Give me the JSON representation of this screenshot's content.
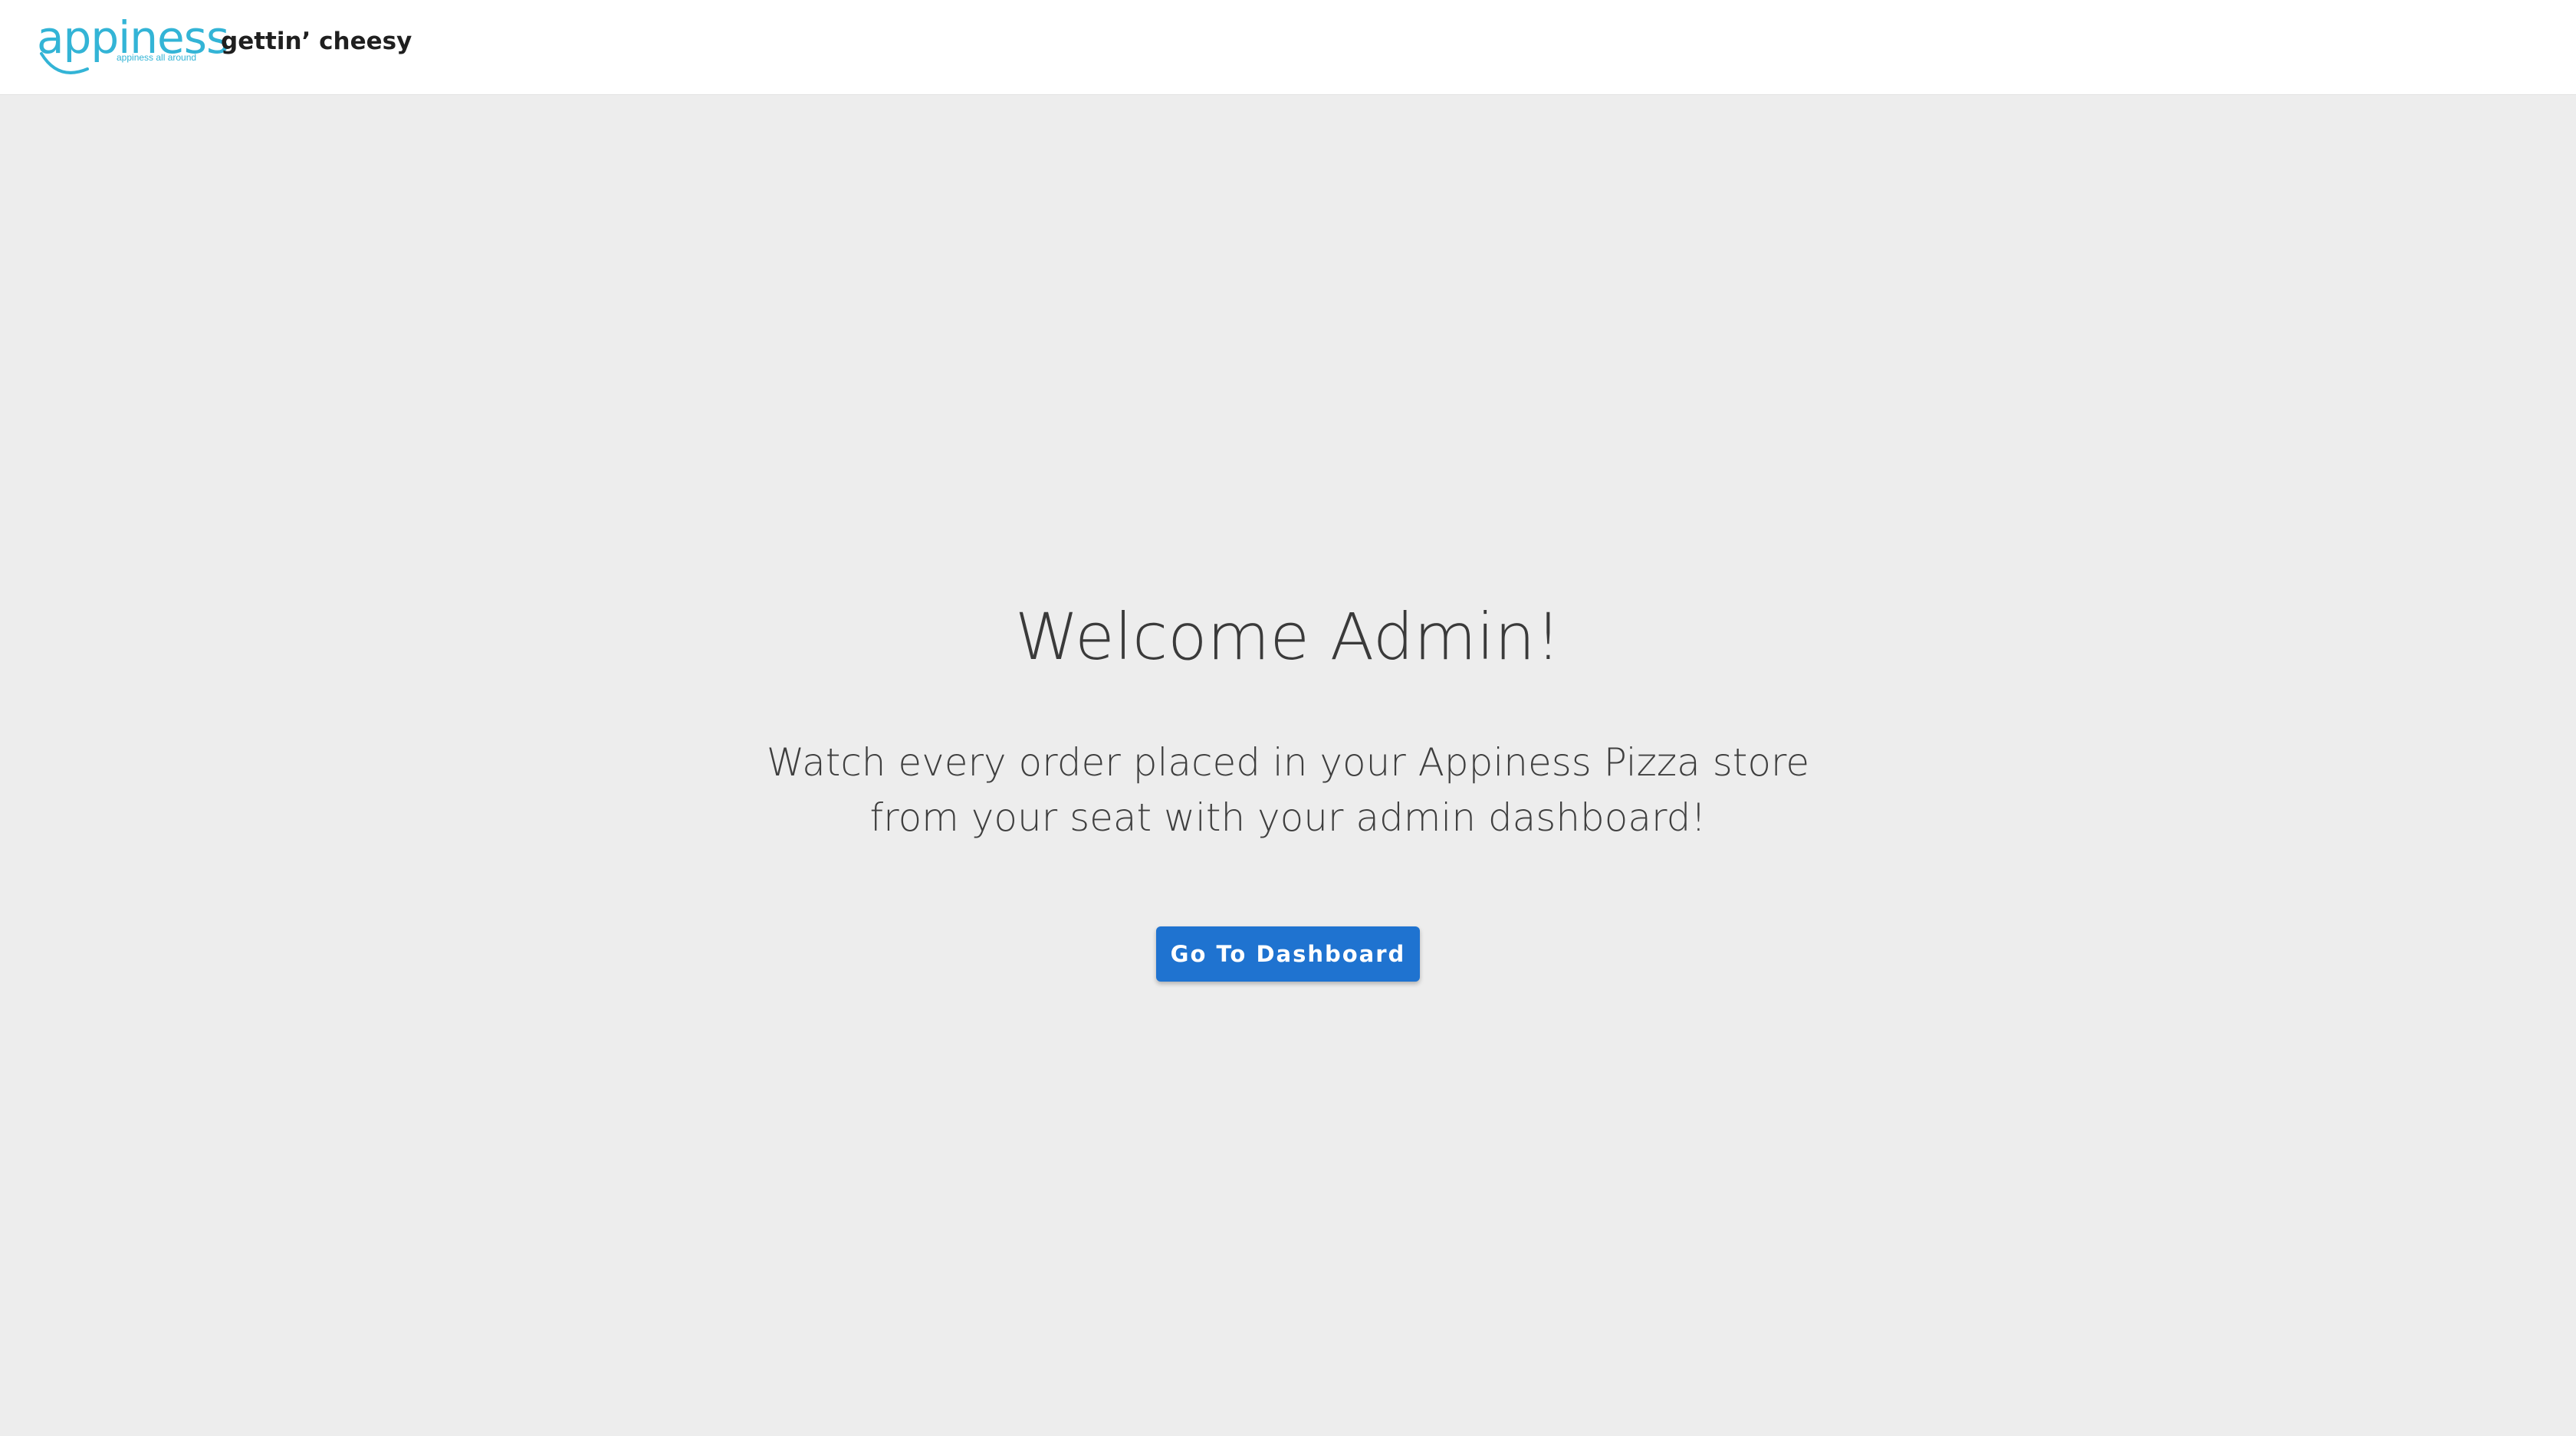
{
  "header": {
    "logo_text": "appiness",
    "logo_tagline": "appiness all around",
    "subtitle": "gettin’ cheesy"
  },
  "main": {
    "title": "Welcome Admin!",
    "description_lines": [
      "Watch every order placed in your Appiness Pizza store",
      "from your seat with your admin dashboard!"
    ],
    "cta_label": "Go To Dashboard"
  },
  "colors": {
    "brand": "#33b4d6",
    "button": "#1f73d0",
    "background": "#ededed",
    "topbar": "#ffffff"
  },
  "icons": {
    "logo_smile": "smile-curve-icon"
  }
}
